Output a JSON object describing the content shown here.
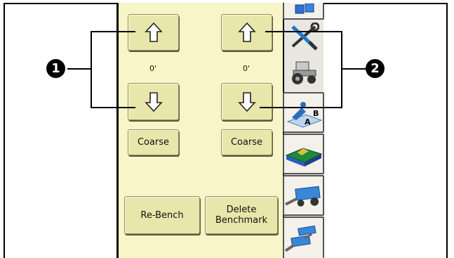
{
  "left_column": {
    "up_label": "up-arrow",
    "value": "0'",
    "down_label": "down-arrow",
    "coarse_label": "Coarse"
  },
  "right_column": {
    "up_label": "up-arrow",
    "value": "0'",
    "down_label": "down-arrow",
    "coarse_label": "Coarse"
  },
  "actions": {
    "rebench_label": "Re-Bench",
    "delete_benchmark_label": "Delete Benchmark"
  },
  "callouts": [
    "1",
    "2"
  ],
  "sidebar": {
    "items": [
      {
        "icon": "blue-block-icon"
      },
      {
        "icon": "tools-icon"
      },
      {
        "icon": "tractor-icon"
      },
      {
        "icon": "ab-line-icon",
        "label_a": "A",
        "label_b": "B"
      },
      {
        "icon": "terrain-map-icon"
      },
      {
        "icon": "scraper-icon"
      },
      {
        "icon": "dual-scraper-icon"
      }
    ]
  }
}
